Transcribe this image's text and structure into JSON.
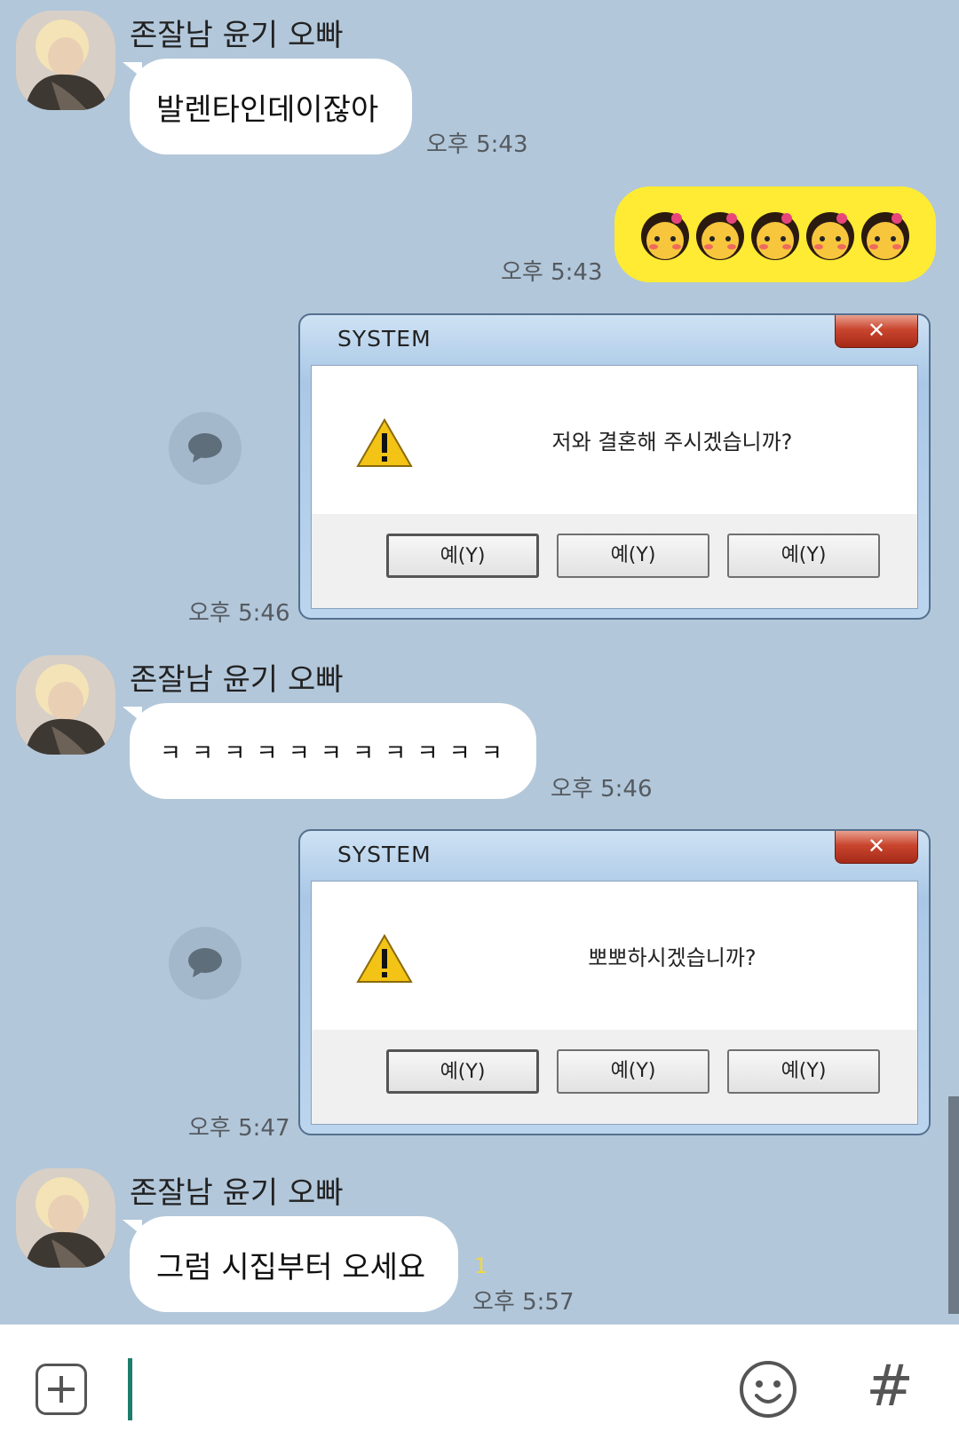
{
  "messages": [
    {
      "sender": "존잘남 윤기 오빠",
      "text": "발렌타인데이잖아",
      "time": "오후 5:43"
    },
    {
      "emoji_count": 5,
      "emoji_name": "blushing-girl-emoji",
      "time": "오후 5:43"
    },
    {
      "dialog": {
        "title": "SYSTEM",
        "close": "✕",
        "message": "저와 결혼해 주시겠습니까?",
        "buttons": [
          "예(Y)",
          "예(Y)",
          "예(Y)"
        ]
      },
      "time": "오후 5:46"
    },
    {
      "sender": "존잘남 윤기 오빠",
      "text": "ㅋ ㅋ ㅋ ㅋ ㅋ ㅋ ㅋ ㅋ ㅋ ㅋ ㅋ",
      "time": "오후 5:46"
    },
    {
      "dialog": {
        "title": "SYSTEM",
        "close": "✕",
        "message": "뽀뽀하시겠습니까?",
        "buttons": [
          "예(Y)",
          "예(Y)",
          "예(Y)"
        ]
      },
      "time": "오후 5:47"
    },
    {
      "sender": "존잘남 윤기 오빠",
      "text": "그럼 시집부터 오세요",
      "time": "오후 5:57",
      "unread": "1"
    }
  ],
  "input_bar": {
    "plus_icon": "plus-icon",
    "emoji_icon": "smiley-icon",
    "hash_label": "#"
  },
  "colors": {
    "background": "#b2c7da",
    "my_bubble": "#ffeb33",
    "other_bubble": "#ffffff",
    "caret": "#1b7d6a"
  }
}
